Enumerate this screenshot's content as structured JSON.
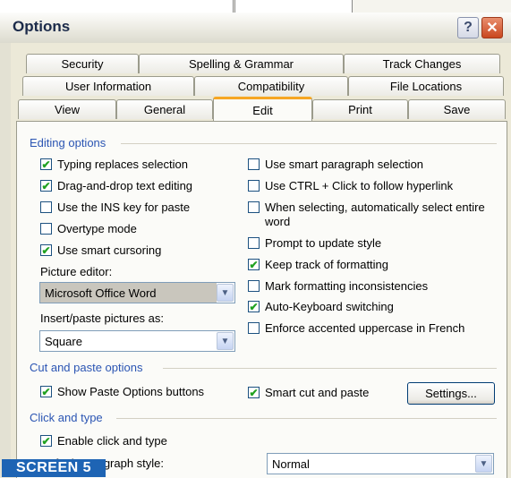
{
  "window": {
    "title": "Options",
    "help": "?",
    "close": "✕"
  },
  "tabs": {
    "row1": [
      "Security",
      "Spelling & Grammar",
      "Track Changes"
    ],
    "row2": [
      "User Information",
      "Compatibility",
      "File Locations"
    ],
    "row3": [
      "View",
      "General",
      "Edit",
      "Print",
      "Save"
    ],
    "active": "Edit"
  },
  "editing": {
    "header": "Editing options",
    "left": [
      {
        "label": "Typing replaces selection",
        "checked": true
      },
      {
        "label": "Drag-and-drop text editing",
        "checked": true
      },
      {
        "label": "Use the INS key for paste",
        "checked": false
      },
      {
        "label": "Overtype mode",
        "checked": false
      },
      {
        "label": "Use smart cursoring",
        "checked": true
      }
    ],
    "picture_editor_label": "Picture editor:",
    "picture_editor_value": "Microsoft Office Word",
    "insert_paste_label": "Insert/paste pictures as:",
    "insert_paste_value": "Square",
    "right": [
      {
        "label": "Use smart paragraph selection",
        "checked": false
      },
      {
        "label": "Use CTRL + Click to follow hyperlink",
        "checked": false
      },
      {
        "label": "When selecting, automatically select entire word",
        "checked": false
      },
      {
        "label": "Prompt to update style",
        "checked": false
      },
      {
        "label": "Keep track of formatting",
        "checked": true
      },
      {
        "label": "Mark formatting inconsistencies",
        "checked": false
      },
      {
        "label": "Auto-Keyboard switching",
        "checked": true
      },
      {
        "label": "Enforce accented uppercase in French",
        "checked": false
      }
    ]
  },
  "cut_paste": {
    "header": "Cut and paste options",
    "show_paste": {
      "label": "Show Paste Options buttons",
      "checked": true
    },
    "smart_cut": {
      "label": "Smart cut and paste",
      "checked": true
    },
    "settings_button": "Settings..."
  },
  "click_type": {
    "header": "Click and type",
    "enable": {
      "label": "Enable click and type",
      "checked": true
    },
    "default_style_label": "Default paragraph style:",
    "default_style_value": "Normal"
  },
  "badge": "SCREEN 5",
  "icons": {
    "check": "check-icon",
    "dropdown": "chevron-down-icon",
    "help": "help-icon",
    "close": "close-icon"
  }
}
